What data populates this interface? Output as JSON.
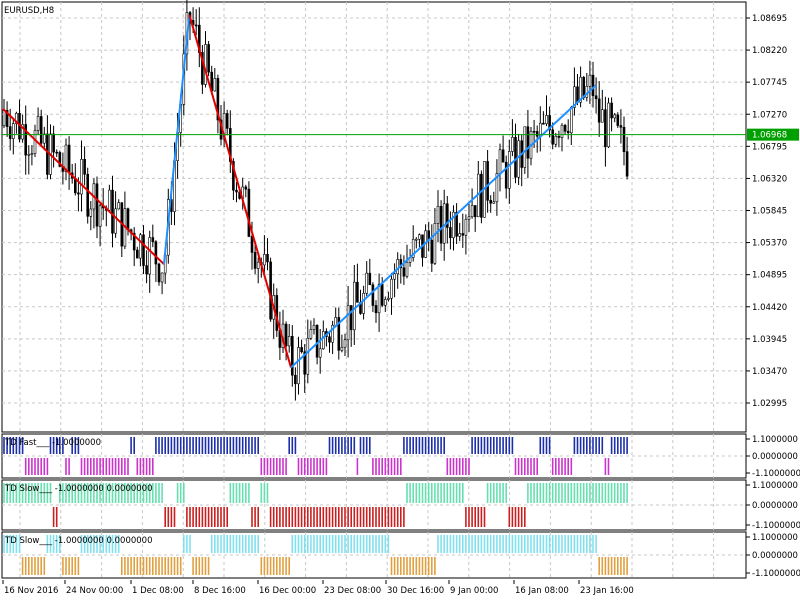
{
  "symbol_label": "EURUSD,H8",
  "main_price_axis": [
    "1.08695",
    "1.08220",
    "1.07745",
    "1.07270",
    "1.06795",
    "1.06320",
    "1.05845",
    "1.05370",
    "1.04895",
    "1.04420",
    "1.03945",
    "1.03470",
    "1.02995"
  ],
  "current_price": "1.06968",
  "time_axis": [
    "16 Nov 2016",
    "24 Nov 00:00",
    "1 Dec 08:00",
    "8 Dec 16:00",
    "16 Dec 00:00",
    "23 Dec 08:00",
    "30 Dec 16:00",
    "9 Jan 00:00",
    "16 Jan 08:00",
    "23 Jan 16:00"
  ],
  "colors": {
    "background": "#ffffff",
    "grid": "#c8c8c8",
    "candle": "#000000",
    "zigzag_down": "#e00000",
    "zigzag_up": "#1e90ff",
    "current_price_line": "#00a000",
    "fast_up": "#1c2fa8",
    "fast_down": "#cc33cc",
    "slow_up": "#66e0b0",
    "slow_down": "#c82020",
    "slow2_up": "#80e0ee",
    "slow2_down": "#e0a040"
  },
  "panels": [
    {
      "title": "TD Fast___",
      "values_label": "-1.0000000",
      "axis": [
        "1.1000000",
        "0.0000000",
        "-1.1000000"
      ]
    },
    {
      "title": "TD Slow___",
      "values_label": "-1.0000000 0.0000000",
      "axis": [
        "1.1000000",
        "0.0000000",
        "-1.1000000"
      ]
    },
    {
      "title": "TD Slow___",
      "values_label": "-1.0000000 0.0000000",
      "axis": [
        "1.1000000",
        "0.0000000",
        "-1.1000000"
      ]
    }
  ],
  "chart_data": {
    "type": "candlestick",
    "symbol": "EURUSD",
    "timeframe": "H8",
    "x_range": [
      "16 Nov 2016",
      "29 Jan 2017"
    ],
    "y_range": [
      1.0275,
      1.089
    ],
    "zigzag": [
      {
        "date": "16 Nov 2016",
        "price": 1.0735
      },
      {
        "date": "5 Dec 2016",
        "price": 1.0505
      },
      {
        "date": "8 Dec 2016",
        "price": 1.0874
      },
      {
        "date": "20 Dec 2016",
        "price": 1.0352
      },
      {
        "date": "25 Jan 2017",
        "price": 1.077
      }
    ],
    "current_price": 1.06968,
    "indicator_fast_states": "-1/+1 alternating signals",
    "indicator_range": [
      -1.1,
      1.1
    ]
  }
}
